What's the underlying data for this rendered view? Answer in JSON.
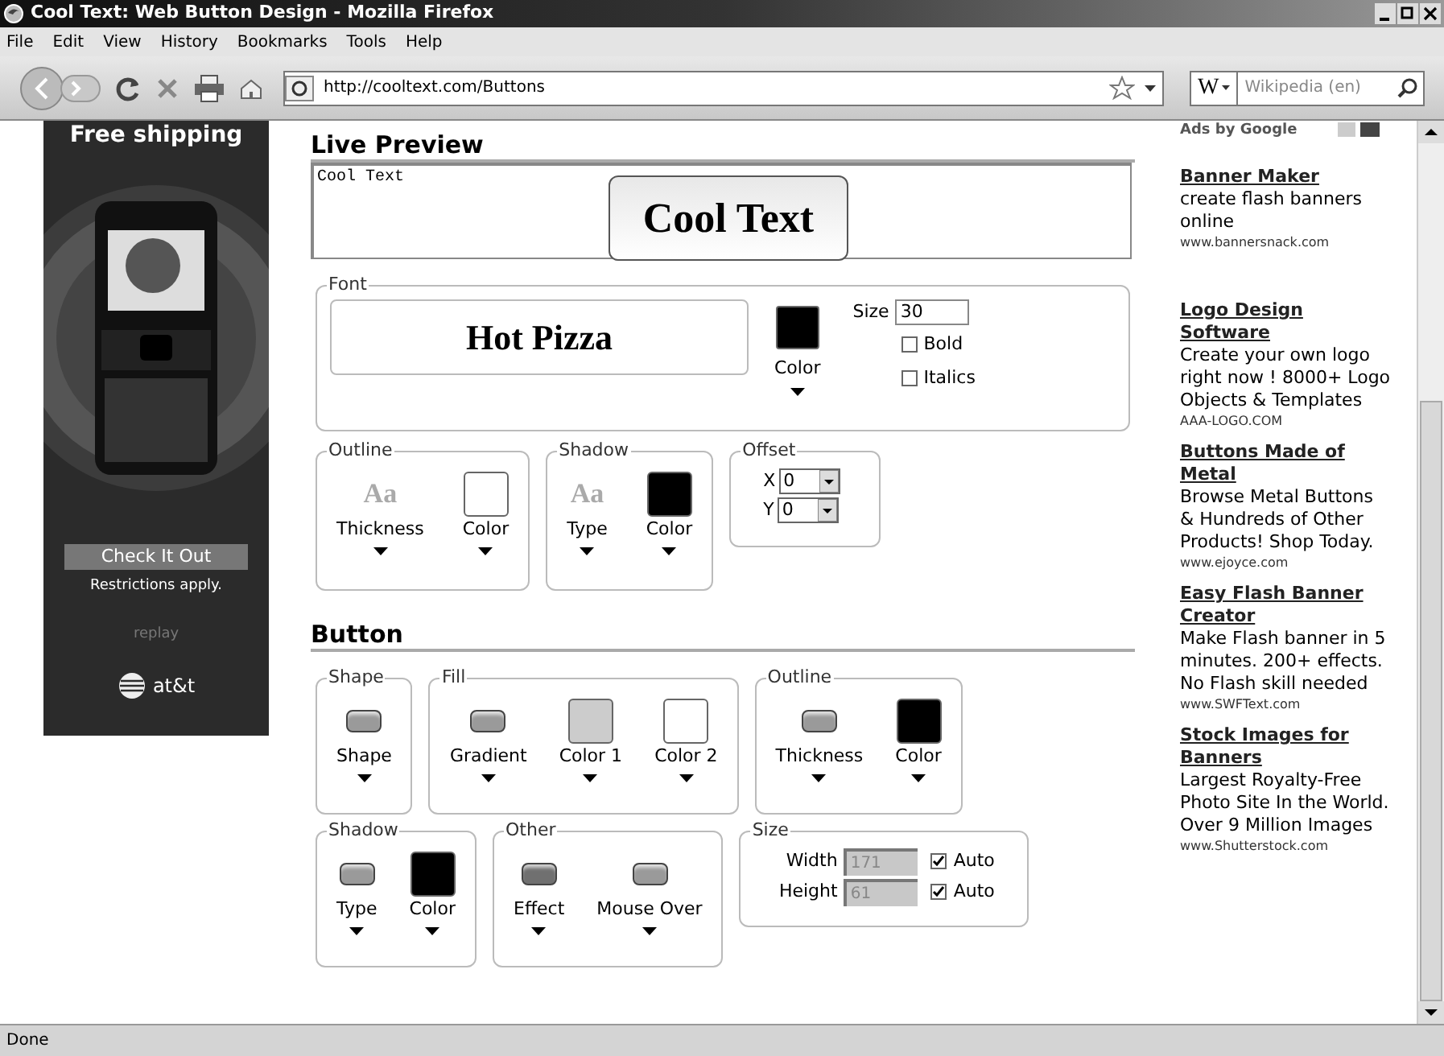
{
  "window": {
    "title": "Cool Text: Web Button Design - Mozilla Firefox"
  },
  "menu": [
    "File",
    "Edit",
    "View",
    "History",
    "Bookmarks",
    "Tools",
    "Help"
  ],
  "toolbar": {
    "url": "http://cooltext.com/Buttons",
    "search_engine": "W",
    "search_placeholder": "Wikipedia (en)"
  },
  "side_ad": {
    "headline": "Free shipping",
    "button": "Check It Out",
    "note": "Restrictions apply.",
    "replay": "replay",
    "brand": "at&t"
  },
  "live_preview": {
    "heading": "Live Preview",
    "text": "Cool Text",
    "preview": "Cool Text"
  },
  "font": {
    "legend": "Font",
    "sample": "Hot Pizza",
    "color_label": "Color",
    "color": "#000000",
    "size_label": "Size",
    "size": "30",
    "options": [
      {
        "label": "Bold",
        "checked": false
      },
      {
        "label": "Italics",
        "checked": false
      }
    ]
  },
  "text_groups": [
    {
      "legend": "Outline",
      "items": [
        {
          "kind": "sample",
          "sample": "Aa",
          "label": "Thickness"
        },
        {
          "kind": "swatch",
          "label": "Color",
          "color": "#ffffff"
        }
      ]
    },
    {
      "legend": "Shadow",
      "items": [
        {
          "kind": "sample",
          "sample": "Aa",
          "label": "Type"
        },
        {
          "kind": "swatch",
          "label": "Color",
          "color": "#000000"
        }
      ]
    }
  ],
  "offset": {
    "legend": "Offset",
    "fields": [
      {
        "label": "X",
        "value": "0"
      },
      {
        "label": "Y",
        "value": "0"
      }
    ]
  },
  "button_heading": "Button",
  "button_groups": [
    {
      "legend": "Shape",
      "items": [
        {
          "kind": "shape",
          "label": "Shape",
          "color": "#9a9a9a"
        }
      ]
    },
    {
      "legend": "Fill",
      "items": [
        {
          "kind": "shape",
          "label": "Gradient",
          "color": "#9a9a9a"
        },
        {
          "kind": "swatch",
          "label": "Color 1",
          "color": "#cccccc"
        },
        {
          "kind": "swatch",
          "label": "Color 2",
          "color": "#ffffff"
        }
      ]
    },
    {
      "legend": "Outline",
      "items": [
        {
          "kind": "shape",
          "label": "Thickness",
          "color": "#9a9a9a"
        },
        {
          "kind": "swatch",
          "label": "Color",
          "color": "#000000"
        }
      ]
    },
    {
      "legend": "Shadow",
      "items": [
        {
          "kind": "shape",
          "label": "Type",
          "color": "#9a9a9a"
        },
        {
          "kind": "swatch",
          "label": "Color",
          "color": "#000000"
        }
      ]
    },
    {
      "legend": "Other",
      "items": [
        {
          "kind": "shape",
          "label": "Effect",
          "color": "#707070"
        },
        {
          "kind": "shape",
          "label": "Mouse Over",
          "color": "#9a9a9a"
        }
      ]
    }
  ],
  "size": {
    "legend": "Size",
    "fields": [
      {
        "label": "Width",
        "value": "171",
        "auto": {
          "label": "Auto",
          "checked": true
        }
      },
      {
        "label": "Height",
        "value": "61",
        "auto": {
          "label": "Auto",
          "checked": true
        }
      }
    ]
  },
  "ads_header": "Ads by Google",
  "ads": [
    {
      "title": "Banner Maker",
      "body": "create flash banners online",
      "url": "www.bannersnack.com"
    },
    {
      "title": "Logo Design Software",
      "body": "Create your own logo right now ! 8000+ Logo Objects & Templates",
      "url": "AAA-LOGO.COM"
    },
    {
      "title": "Buttons Made of Metal",
      "body": "Browse Metal Buttons & Hundreds of Other Products! Shop Today.",
      "url": "www.ejoyce.com"
    },
    {
      "title": "Easy Flash Banner Creator",
      "body": "Make Flash banner in 5 minutes. 200+ effects. No Flash skill needed",
      "url": "www.SWFText.com"
    },
    {
      "title": "Stock Images for Banners",
      "body": "Largest Royalty-Free Photo Site In the World. Over 9 Million Images",
      "url": "www.Shutterstock.com"
    }
  ],
  "status_bar": "Done"
}
